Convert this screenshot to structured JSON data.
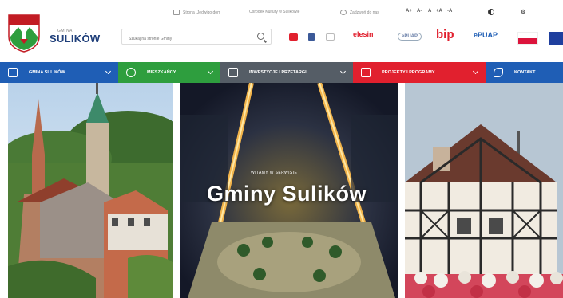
{
  "logo": {
    "small": "GMINA",
    "big": "SULIKÓW"
  },
  "utility": {
    "link1": "Strona „Jedwigo dom",
    "link2": "Ośrodek Kultury w Sulikowie",
    "link3": "Zadzwoń do nas",
    "access": [
      "A+",
      "A-",
      "A",
      "+A",
      "-A"
    ]
  },
  "search": {
    "placeholder": "Szukaj na stronie Gminy"
  },
  "social": [
    "youtube-icon",
    "facebook-icon",
    "instagram-icon"
  ],
  "partners": [
    "elesin",
    "ePUAP",
    "bip",
    "ePUAP"
  ],
  "nav": {
    "items": [
      {
        "label": "GMINA SULIKÓW",
        "color": "#1f5eb5"
      },
      {
        "label": "MIESZKAŃCY",
        "color": "#2e9e3e"
      },
      {
        "label": "INWESTYCJE I PRZETARGI",
        "color": "#555d66"
      },
      {
        "label": "PROJEKTY I PROGRAMY",
        "color": "#e1202e"
      },
      {
        "label": "KONTAKT",
        "color": "#1f5eb5"
      }
    ]
  },
  "hero": {
    "subtitle": "WITAMY W SERWISIE",
    "title": "Gminy Sulików"
  },
  "colors": {
    "accent_blue": "#1f5eb5",
    "accent_green": "#2e9e3e",
    "accent_red": "#e1202e",
    "accent_gray": "#555d66"
  }
}
